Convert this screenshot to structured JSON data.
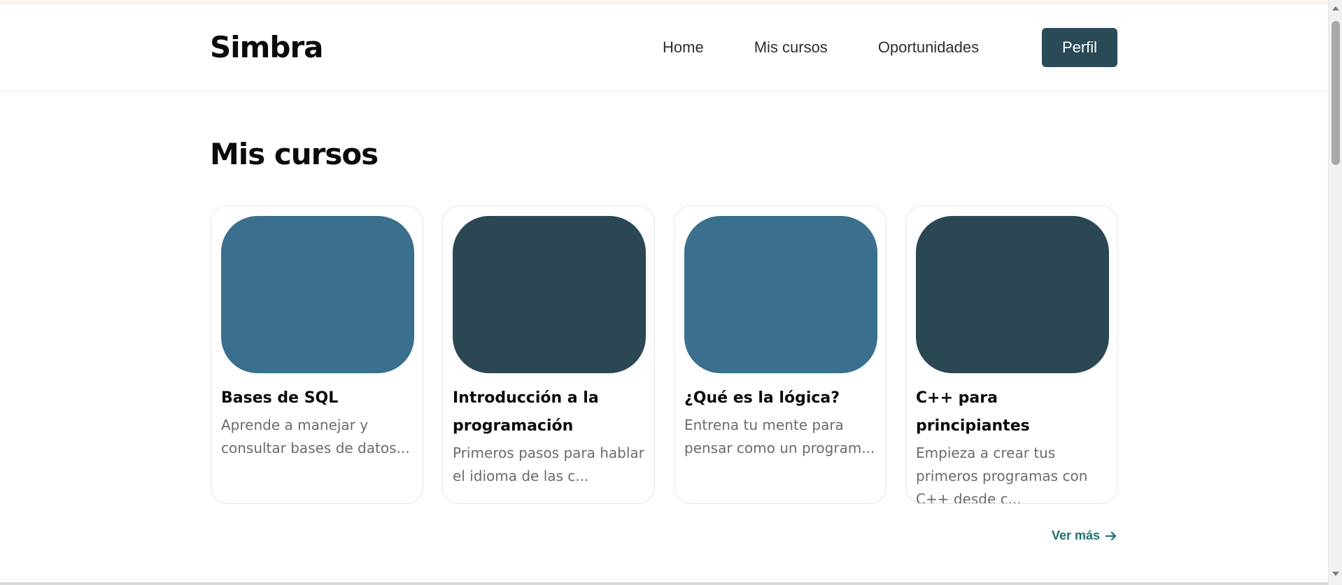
{
  "brand": {
    "name": "Simbra"
  },
  "nav": {
    "links": [
      {
        "label": "Home"
      },
      {
        "label": "Mis cursos"
      },
      {
        "label": "Oportunidades"
      }
    ],
    "profile_label": "Perfil"
  },
  "page": {
    "title": "Mis cursos"
  },
  "courses": [
    {
      "title": "Bases de SQL",
      "description": "Aprende a manejar y consultar bases de datos...",
      "color": "#3a6f8d"
    },
    {
      "title": "Introducción a la programación",
      "description": "Primeros pasos para hablar el idioma de las c...",
      "color": "#2b4754"
    },
    {
      "title": "¿Qué es la lógica?",
      "description": "Entrena tu mente para pensar como un program...",
      "color": "#3a6f8d"
    },
    {
      "title": "C++ para principiantes",
      "description": "Empieza a crear tus primeros programas con C++ desde c...",
      "color": "#2b4754"
    }
  ],
  "see_more": {
    "label": "Ver más"
  },
  "colors": {
    "primary": "#2a4a57",
    "accent_link": "#1f7070"
  },
  "icons": {
    "see_more": "arrow-right-icon"
  }
}
